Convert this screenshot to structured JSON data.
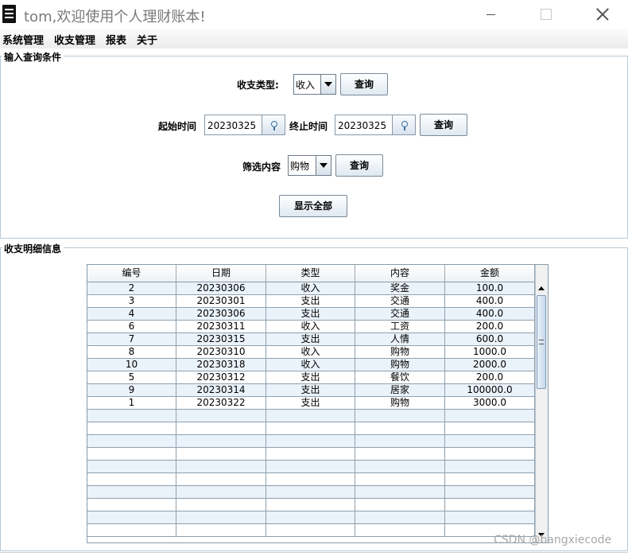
{
  "window": {
    "title": "tom,欢迎使用个人理财账本!"
  },
  "menu": [
    "系统管理",
    "收支管理",
    "报表",
    "关于"
  ],
  "query_panel": {
    "legend": "输入查询条件",
    "type_label": "收支类型:",
    "type_value": "收入",
    "type_query_button": "查询",
    "start_label": "起始时间",
    "start_value": "20230325",
    "end_label": "终止时间",
    "end_value": "20230325",
    "date_query_button": "查询",
    "filter_label": "筛选内容",
    "filter_value": "购物",
    "filter_query_button": "查询",
    "show_all_button": "显示全部"
  },
  "detail_panel": {
    "legend": "收支明细信息",
    "columns": [
      "编号",
      "日期",
      "类型",
      "内容",
      "金额"
    ],
    "rows": [
      [
        "2",
        "20230306",
        "收入",
        "奖金",
        "100.0"
      ],
      [
        "3",
        "20230301",
        "支出",
        "交通",
        "400.0"
      ],
      [
        "4",
        "20230306",
        "支出",
        "交通",
        "400.0"
      ],
      [
        "6",
        "20230311",
        "收入",
        "工资",
        "200.0"
      ],
      [
        "7",
        "20230315",
        "支出",
        "人情",
        "600.0"
      ],
      [
        "8",
        "20230310",
        "收入",
        "购物",
        "1000.0"
      ],
      [
        "10",
        "20230318",
        "收入",
        "购物",
        "2000.0"
      ],
      [
        "5",
        "20230312",
        "支出",
        "餐饮",
        "200.0"
      ],
      [
        "9",
        "20230314",
        "支出",
        "居家",
        "100000.0"
      ],
      [
        "1",
        "20230322",
        "支出",
        "购物",
        "3000.0"
      ]
    ],
    "empty_row_count": 10
  },
  "watermark": "CSDN @bangxiecode"
}
